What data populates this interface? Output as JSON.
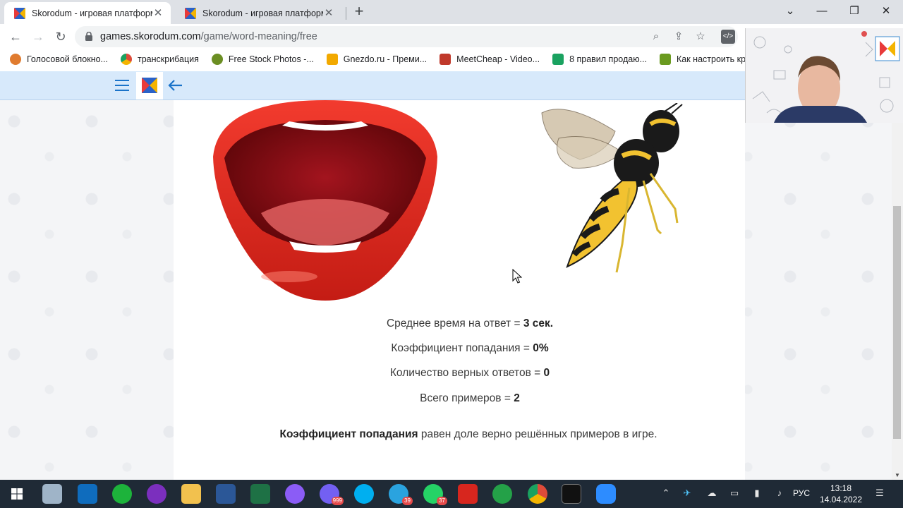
{
  "browser": {
    "tabs": [
      {
        "title": "Skorodum - игровая платформа",
        "active": true
      },
      {
        "title": "Skorodum - игровая платформа",
        "active": false
      }
    ],
    "new_tab_symbol": "+",
    "close_symbol": "✕",
    "window_controls": {
      "list": "⌄",
      "minimize": "—",
      "restore": "❐",
      "close": "✕"
    },
    "url_host": "games.skorodum.com",
    "url_path": "/game/word-meaning/free",
    "bookmarks": [
      {
        "label": "Голосовой блокно...",
        "icon": "parrot-icon",
        "color": "#e07b2f"
      },
      {
        "label": "транскрибация",
        "icon": "chrome-icon",
        "color": "#dd4b39"
      },
      {
        "label": "Free Stock Photos -...",
        "icon": "pexels-icon",
        "color": "#6b8e23"
      },
      {
        "label": "Gnezdo.ru - Преми...",
        "icon": "gnezdo-icon",
        "color": "#f2a900"
      },
      {
        "label": "MeetCheap - Video...",
        "icon": "meetcheap-icon",
        "color": "#c0392b"
      },
      {
        "label": "8 правил продаю...",
        "icon": "checkbox-icon",
        "color": "#1aa260"
      },
      {
        "label": "Как настроить кро...",
        "icon": "p-icon",
        "color": "#6a9a1f"
      }
    ]
  },
  "app": {
    "brand_colors": {
      "header_bg": "#d7e9fb",
      "accent": "#1a73c9",
      "red": "#e83a3a",
      "yellow": "#f4b400",
      "blue": "#2a62c8"
    }
  },
  "game": {
    "images": {
      "left": "lips",
      "right": "wasp"
    },
    "stats": {
      "time_label": "Среднее время на ответ = ",
      "time_value": "3 сек.",
      "accuracy_label": "Коэффициент попадания = ",
      "accuracy_value": "0%",
      "correct_label": "Количество верных ответов = ",
      "correct_value": "0",
      "total_label": "Всего примеров = ",
      "total_value": "2"
    },
    "explanation_bold": "Коэффициент попадания",
    "explanation_rest": " равен доле верно решённых примеров в игре."
  },
  "taskbar": {
    "apps": [
      {
        "name": "start",
        "icon": "windows-icon",
        "color": "#ffffff"
      },
      {
        "name": "explorer-window",
        "icon": "window-icon",
        "color": "#9fb4c8"
      },
      {
        "name": "outlook",
        "icon": "outlook-icon",
        "color": "#0f6cbd"
      },
      {
        "name": "evernote",
        "icon": "evernote-icon",
        "color": "#1db33b"
      },
      {
        "name": "app-purple",
        "icon": "purple-app-icon",
        "color": "#7b2fbe"
      },
      {
        "name": "file-explorer",
        "icon": "folder-icon",
        "color": "#f2c14e"
      },
      {
        "name": "word",
        "icon": "word-icon",
        "color": "#2b5797"
      },
      {
        "name": "excel",
        "icon": "excel-icon",
        "color": "#1e7145"
      },
      {
        "name": "messenger",
        "icon": "messenger-icon",
        "color": "#8b5cf6"
      },
      {
        "name": "viber",
        "icon": "viber-icon",
        "color": "#7360f2",
        "badge": "999"
      },
      {
        "name": "skype",
        "icon": "skype-icon",
        "color": "#00aff0"
      },
      {
        "name": "telegram",
        "icon": "telegram-icon",
        "color": "#2aa3df",
        "badge": "39"
      },
      {
        "name": "whatsapp",
        "icon": "whatsapp-icon",
        "color": "#25d366",
        "badge": "37"
      },
      {
        "name": "acrobat",
        "icon": "acrobat-icon",
        "color": "#d7261e"
      },
      {
        "name": "clover",
        "icon": "clover-icon",
        "color": "#24a148"
      },
      {
        "name": "chrome",
        "icon": "chrome-icon",
        "color": "#dd4b39"
      },
      {
        "name": "terminal",
        "icon": "terminal-icon",
        "color": "#111111"
      },
      {
        "name": "zoom",
        "icon": "zoom-icon",
        "color": "#2d8cff"
      }
    ],
    "language": "РУС",
    "time": "13:18",
    "date": "14.04.2022"
  }
}
